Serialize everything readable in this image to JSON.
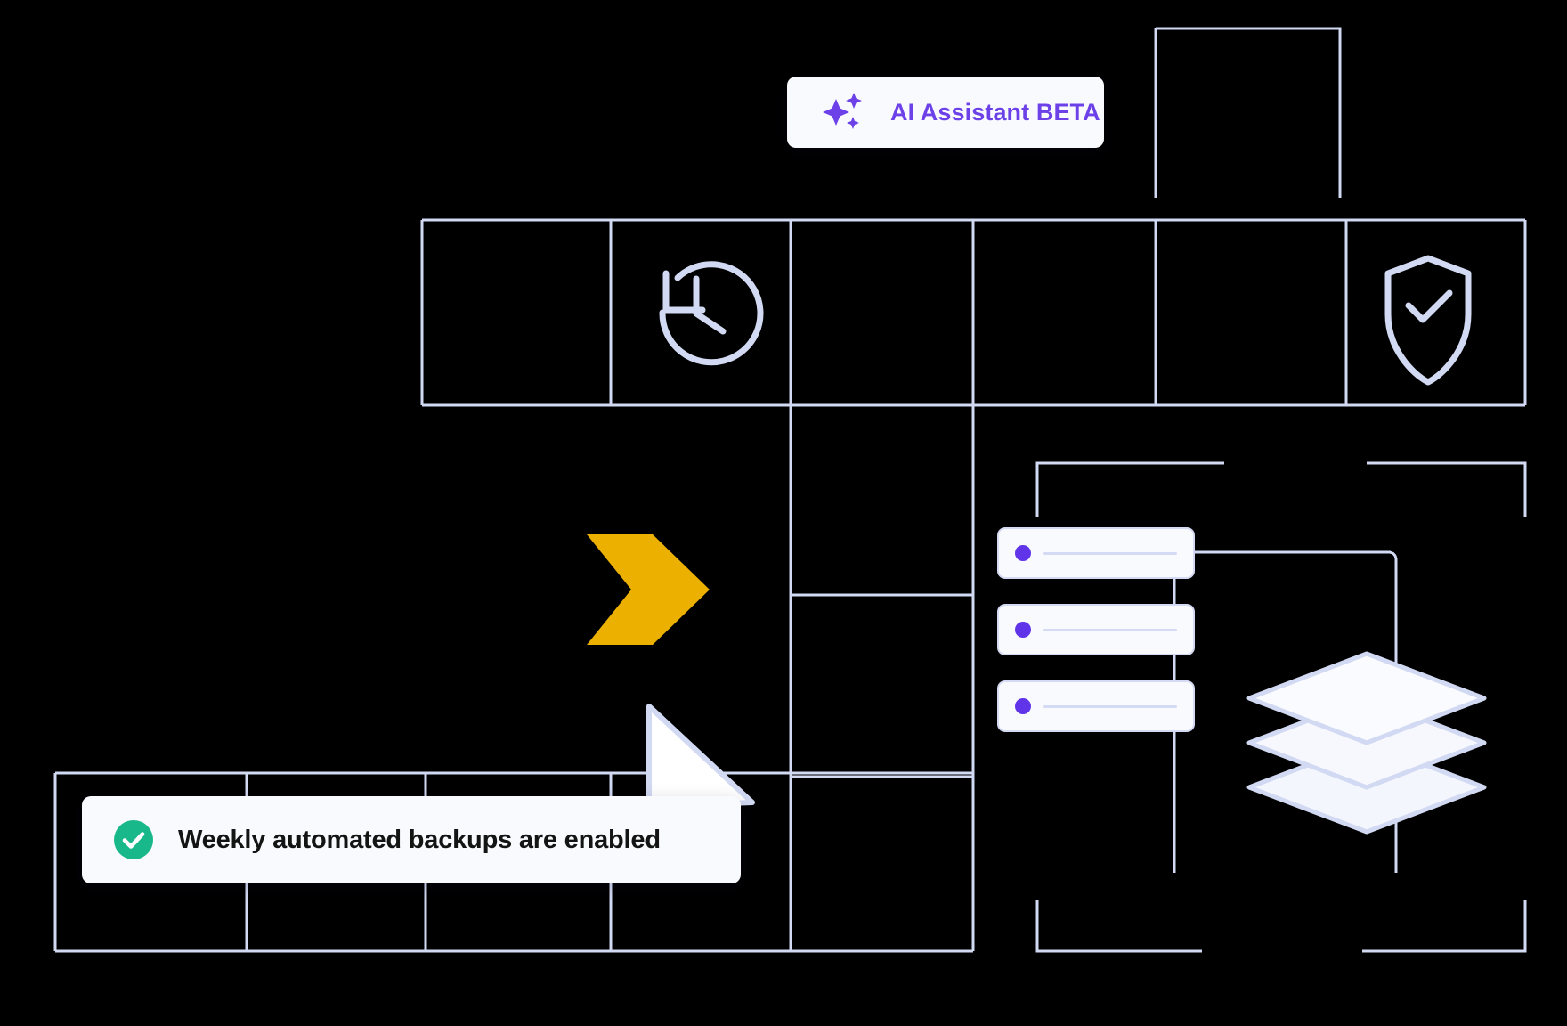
{
  "theme": {
    "background": "#000000",
    "grid_line": "#D2D9F2",
    "card_background": "#F9FAFE",
    "accent_purple": "#6C41E8",
    "accent_amber": "#ECB001",
    "accent_green": "#18B88A",
    "text_dark": "#141414"
  },
  "ai_badge": {
    "label": "AI Assistant BETA",
    "icon": "sparkle-icon",
    "text_color": "#6C41E8"
  },
  "backup_toast": {
    "label": "Weekly automated backups are enabled",
    "icon": "check-circle-icon",
    "icon_color": "#18B88A",
    "text_color": "#141414"
  },
  "icons": {
    "history": "history-clock-icon",
    "shield": "shield-check-icon",
    "chevron": "chevron-right-icon",
    "cursor": "mouse-cursor-icon",
    "layers": "layers-stack-icon"
  },
  "server_panel": {
    "rows": [
      {
        "dot_color": "#6034E8"
      },
      {
        "dot_color": "#6034E8"
      },
      {
        "dot_color": "#6034E8"
      }
    ]
  }
}
